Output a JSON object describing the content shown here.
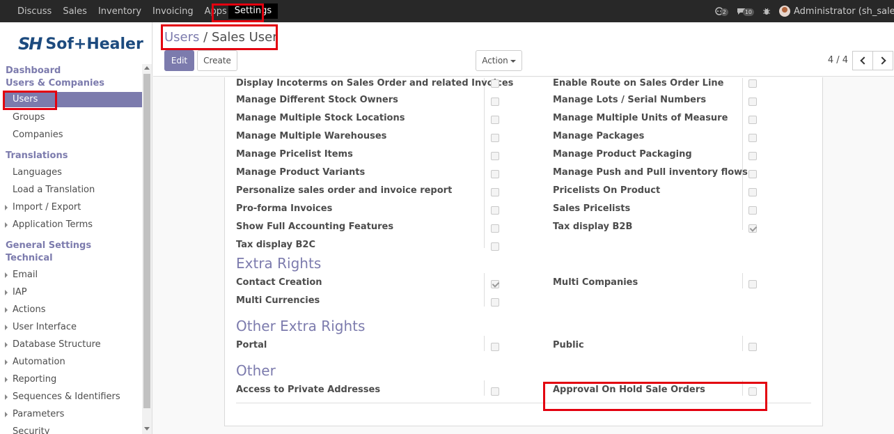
{
  "topbar": {
    "menu": [
      "Discuss",
      "Sales",
      "Inventory",
      "Invoicing",
      "Apps"
    ],
    "active_menu": "Settings",
    "chat_count": "2",
    "activity_count": "10",
    "user": "Administrator (sh_sale_..."
  },
  "sidebar": {
    "logo_mark": "SH",
    "logo_word": "Sof+Healer",
    "sections": {
      "dashboard": "Dashboard",
      "users_companies": "Users & Companies",
      "users": "Users",
      "groups": "Groups",
      "companies": "Companies",
      "translations": "Translations",
      "languages": "Languages",
      "load_translation": "Load a Translation",
      "import_export": "Import / Export",
      "application_terms": "Application Terms",
      "general_settings": "General Settings",
      "technical": "Technical",
      "email": "Email",
      "iap": "IAP",
      "actions": "Actions",
      "user_interface": "User Interface",
      "database_structure": "Database Structure",
      "automation": "Automation",
      "reporting": "Reporting",
      "sequences": "Sequences & Identifiers",
      "parameters": "Parameters",
      "security": "Security"
    }
  },
  "breadcrumb": {
    "parent": "Users",
    "separator": "/",
    "current": "Sales User"
  },
  "buttons": {
    "edit": "Edit",
    "create": "Create",
    "action": "Action"
  },
  "pager": "4 / 4",
  "rights": {
    "left": [
      {
        "label": "Display Incoterms on Sales Order and related Invoices",
        "checked": false
      },
      {
        "label": "Manage Different Stock Owners",
        "checked": false
      },
      {
        "label": "Manage Multiple Stock Locations",
        "checked": false
      },
      {
        "label": "Manage Multiple Warehouses",
        "checked": false
      },
      {
        "label": "Manage Pricelist Items",
        "checked": false
      },
      {
        "label": "Manage Product Variants",
        "checked": false
      },
      {
        "label": "Personalize sales order and invoice report",
        "checked": false
      },
      {
        "label": "Pro-forma Invoices",
        "checked": false
      },
      {
        "label": "Show Full Accounting Features",
        "checked": false
      },
      {
        "label": "Tax display B2C",
        "checked": false
      }
    ],
    "right": [
      {
        "label": "Enable Route on Sales Order Line",
        "checked": false
      },
      {
        "label": "Manage Lots / Serial Numbers",
        "checked": false
      },
      {
        "label": "Manage Multiple Units of Measure",
        "checked": false
      },
      {
        "label": "Manage Packages",
        "checked": false
      },
      {
        "label": "Manage Product Packaging",
        "checked": false
      },
      {
        "label": "Manage Push and Pull inventory flows",
        "checked": false
      },
      {
        "label": "Pricelists On Product",
        "checked": false
      },
      {
        "label": "Sales Pricelists",
        "checked": false
      },
      {
        "label": "Tax display B2B",
        "checked": true
      }
    ]
  },
  "extra_rights": {
    "title": "Extra Rights",
    "contact_creation": "Contact Creation",
    "multi_companies": "Multi Companies",
    "multi_currencies": "Multi Currencies"
  },
  "other_extra_rights": {
    "title": "Other Extra Rights",
    "portal": "Portal",
    "public": "Public"
  },
  "other": {
    "title": "Other",
    "private_addresses": "Access to Private Addresses",
    "approval_on_hold": "Approval On Hold Sale Orders"
  },
  "colors": {
    "accent": "#7c7bad",
    "highlight": "#e3000f",
    "navbar": "#282828"
  }
}
